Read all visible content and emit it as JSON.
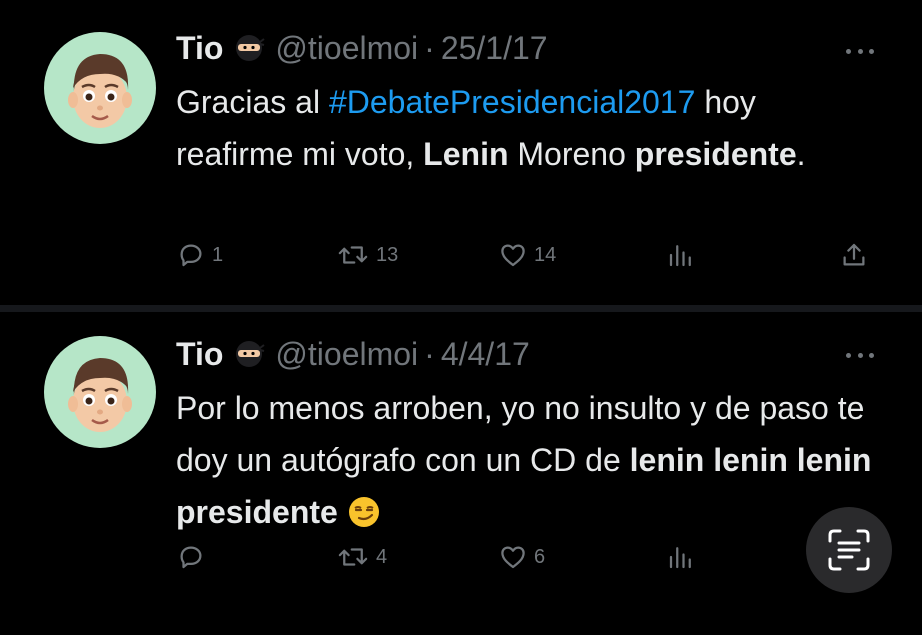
{
  "tweets": [
    {
      "author_name": "Tio",
      "handle": "@tioelmoi",
      "separator": "·",
      "date": "25/1/17",
      "text_segments": [
        {
          "text": "Gracias al ",
          "style": "normal"
        },
        {
          "text": "#DebatePresidencial2017",
          "style": "hashtag"
        },
        {
          "text": " hoy reafirme mi voto, ",
          "style": "normal"
        },
        {
          "text": "Lenin",
          "style": "bold"
        },
        {
          "text": " Moreno ",
          "style": "normal"
        },
        {
          "text": "presidente",
          "style": "bold"
        },
        {
          "text": ".",
          "style": "normal"
        }
      ],
      "replies": "1",
      "retweets": "13",
      "likes": "14"
    },
    {
      "author_name": "Tio",
      "handle": "@tioelmoi",
      "separator": "·",
      "date": "4/4/17",
      "text_segments": [
        {
          "text": "Por lo menos arroben, yo no insulto y de paso te doy un autógrafo con un CD de ",
          "style": "normal"
        },
        {
          "text": "lenin lenin lenin presidente",
          "style": "bold"
        },
        {
          "text": " ",
          "style": "normal"
        }
      ],
      "replies": "",
      "retweets": "4",
      "likes": "6"
    }
  ],
  "icons": {
    "author_badge": "ninja-emoji-icon",
    "emoji_end_tweet2": "smirking-face-emoji-icon",
    "reply": "reply-icon",
    "retweet": "retweet-icon",
    "like": "heart-icon",
    "views": "views-icon",
    "share": "share-icon",
    "more": "more-icon",
    "scan": "text-scan-icon"
  },
  "colors": {
    "background": "#000000",
    "text": "#e7e9ea",
    "secondary": "#71767b",
    "link": "#1d9bf0",
    "avatar_bg": "#b6e6c8"
  }
}
